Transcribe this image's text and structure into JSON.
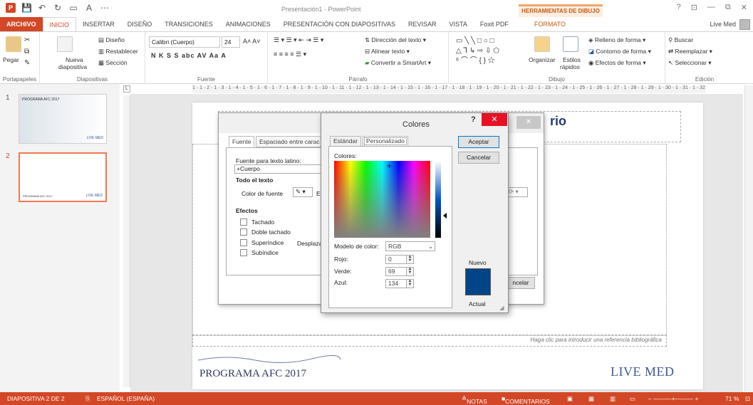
{
  "window": {
    "title": "Presentación1 - PowerPoint",
    "context_band": "HERRAMIENTAS DE DIBUJO",
    "controls": [
      "?",
      "⊡",
      "—",
      "⧉",
      "✕"
    ]
  },
  "qat": {
    "app_icon": "P"
  },
  "tabs": {
    "items": [
      "ARCHIVO",
      "INICIO",
      "INSERTAR",
      "DISEÑO",
      "TRANSICIONES",
      "ANIMACIONES",
      "PRESENTACIÓN CON DIAPOSITIVAS",
      "REVISAR",
      "VISTA",
      "Foxit PDF"
    ],
    "formato": "FORMATO",
    "user": "Live Med"
  },
  "ribbon": {
    "portapapeles": {
      "label": "Portapapeles",
      "pegar": "Pegar"
    },
    "diapositivas": {
      "label": "Diapositivas",
      "nueva": "Nueva",
      "nueva2": "diapositiva",
      "diseno": "Diseño",
      "restablecer": "Restablecer",
      "seccion": "Sección"
    },
    "fuente": {
      "label": "Fuente",
      "font": "Calibri (Cuerpo)",
      "size": "24",
      "format_row": "N K S S abc AV Aa A"
    },
    "parrafo": {
      "label": "Párrafo",
      "direccion": "Dirección del texto",
      "alinear": "Alinear texto",
      "smartart": "Convertir a SmartArt"
    },
    "dibujo": {
      "label": "Dibujo",
      "organizar": "Organizar",
      "estilos": "Estilos",
      "rapidos": "rápidos",
      "relleno": "Relleno de forma",
      "contorno": "Contorno de forma",
      "efectos": "Efectos de forma"
    },
    "edicion": {
      "label": "Edición",
      "buscar": "Buscar",
      "reemplazar": "Reemplazar",
      "seleccionar": "Seleccionar"
    }
  },
  "ruler": {
    "marks": "1 · 1 · 2 · 1 · 3 · 1 · 4 · 1 · 5 · 1 · 6 · 1 · 7 · 1 · 8 · 1 · 9 · 1 · 10 · 1 · 11 · 1 · 12 · 1 · 13 · 1 · 14 · 1 · 15 · 1 · 16 · 1 · 17 · 1 · 18 · 1 · 19 · 1 · 20 · 1 · 21 · 1 · 22 · 1 · 23 · 1 · 24 · 1 · 25 · 1 · 26 · 1 · 27 · 1 · 28 · 1 · 29 · 1 · 30 · 1 · 31 · 1 · 32 · 1 · 33"
  },
  "thumbnails": [
    {
      "num": "1",
      "label": "PROGRAMA AFC 2017",
      "brand": "LIVE MED"
    },
    {
      "num": "2",
      "label": "",
      "footer": "PROGRAMA AFC 2017",
      "brand": "LIVE MED"
    }
  ],
  "slide": {
    "title_fragment": "rio",
    "reference_placeholder": "Haga clic para introducir una referencia bibliográfica",
    "footer_text": "PROGRAMA AFC 2017",
    "brand": "LIVE MED"
  },
  "font_dialog": {
    "tabs": [
      "Fuente",
      "Espaciado entre carac"
    ],
    "latin_label": "Fuente para texto latino:",
    "latin_value": "+Cuerpo",
    "todo_texto": "Todo el texto",
    "color_fuente": "Color de fuente",
    "color_fuente_e": "E",
    "efectos": "Efectos",
    "tachado": "Tachado",
    "doble_tachado": "Doble tachado",
    "superindice": "Superíndice",
    "desplaza": "Desplaza",
    "subindice": "Subíndice",
    "cancelar": "ncelar"
  },
  "color_dialog": {
    "title": "Colores",
    "help": "?",
    "close": "✕",
    "tabs": [
      "Estándar",
      "Personalizado"
    ],
    "colores_label": "Colores:",
    "modelo_label": "Modelo de color:",
    "modelo_value": "RGB",
    "rojo_label": "Rojo:",
    "rojo": "0",
    "verde_label": "Verde:",
    "verde": "69",
    "azul_label": "Azul:",
    "azul": "134",
    "aceptar": "Aceptar",
    "cancelar": "Cancelar",
    "nuevo": "Nuevo",
    "actual": "Actual",
    "new_color": "#004586"
  },
  "status": {
    "slide": "DIAPOSITIVA 2 DE 2",
    "language": "ESPAÑOL (ESPAÑA)",
    "notas": "NOTAS",
    "comentarios": "COMENTARIOS",
    "zoom": "71 %"
  },
  "colors": {
    "accent": "#d24726",
    "title_blue": "#1f3a7a"
  }
}
